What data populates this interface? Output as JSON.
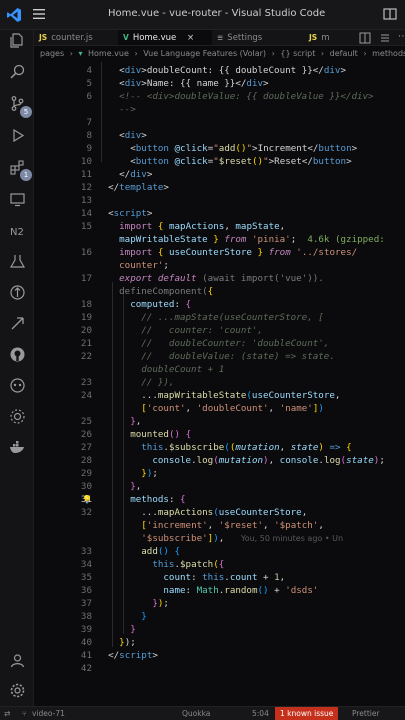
{
  "window": {
    "title": "Home.vue - vue-router - Visual Studio Code"
  },
  "tabs": [
    {
      "icon": "JS",
      "label": "counter.js"
    },
    {
      "icon": "V",
      "label": "Home.vue"
    },
    {
      "icon": "≡",
      "label": "Settings"
    },
    {
      "icon": "JS",
      "label": "m"
    }
  ],
  "breadcrumb": {
    "items": [
      "pages",
      "›",
      "Home.vue",
      "›",
      "Vue Language Features (Volar)",
      "›",
      "{} script",
      "›",
      "default",
      "›",
      "methods"
    ]
  },
  "activity_bar": {
    "badges": {
      "source_control": "5",
      "extensions": "1"
    }
  },
  "editor": {
    "lines": [
      {
        "n": "4",
        "html": "    <span class=\"p\">&lt;</span><span class=\"t\">div</span><span class=\"p\">&gt;doubleCount: {{ doubleCount }}&lt;/</span><span class=\"t\">div</span><span class=\"p\">&gt;</span>"
      },
      {
        "n": "5",
        "html": "    <span class=\"p\">&lt;</span><span class=\"t\">div</span><span class=\"p\">&gt;Name: {{ name }}&lt;/</span><span class=\"t\">div</span><span class=\"p\">&gt;</span>"
      },
      {
        "n": "6",
        "html": "    <span class=\"cm\">&lt;!-- &lt;div&gt;doubleValue: {{ doubleValue }}&lt;/div&gt;</span>"
      },
      {
        "n": "",
        "html": "    <span class=\"cm\">--&gt;</span>"
      },
      {
        "n": "7",
        "html": ""
      },
      {
        "n": "8",
        "html": "    <span class=\"p\">&lt;</span><span class=\"t\">div</span><span class=\"p\">&gt;</span>"
      },
      {
        "n": "9",
        "html": "      <span class=\"p\">&lt;</span><span class=\"t\">button</span> <span class=\"a\">@click</span><span class=\"p\">=</span><span class=\"s\">\"</span><span class=\"f\">add</span><span class=\"y\">()</span><span class=\"s\">\"</span><span class=\"p\">&gt;Increment&lt;/</span><span class=\"t\">button</span><span class=\"p\">&gt;</span>"
      },
      {
        "n": "10",
        "html": "      <span class=\"p\">&lt;</span><span class=\"t\">button</span> <span class=\"a\">@click</span><span class=\"p\">=</span><span class=\"s\">\"</span><span class=\"f\">$reset</span><span class=\"y\">()</span><span class=\"s\">\"</span><span class=\"p\">&gt;Reset&lt;/</span><span class=\"t\">button</span><span class=\"p\">&gt;</span>"
      },
      {
        "n": "11",
        "html": "    <span class=\"p\">&lt;/</span><span class=\"t\">div</span><span class=\"p\">&gt;</span>"
      },
      {
        "n": "12",
        "html": "  <span class=\"p\">&lt;/</span><span class=\"t\">template</span><span class=\"p\">&gt;</span>"
      },
      {
        "n": "13",
        "html": ""
      },
      {
        "n": "14",
        "html": "  <span class=\"p\">&lt;</span><span class=\"t\">script</span><span class=\"p\">&gt;</span>"
      },
      {
        "n": "15",
        "html": "    <span class=\"k\">import</span> <span class=\"y\">{</span> <span class=\"v\">mapActions</span>, <span class=\"v\">mapState</span>,"
      },
      {
        "n": "",
        "html": "    <span class=\"v\">mapWritableState</span> <span class=\"y\">}</span> <span class=\"kit\">from</span> <span class=\"s\">'pinia'</span>;  <span class=\"hint\">4.6k (gzipped:</span>"
      },
      {
        "n": "16",
        "html": "    <span class=\"k\">import</span> <span class=\"y\">{</span> <span class=\"v\">useCounterStore</span> <span class=\"y\">}</span> <span class=\"kit\">from</span> <span class=\"s\">'../stores/</span>"
      },
      {
        "n": "",
        "html": "    <span class=\"s\">counter'</span>;"
      },
      {
        "n": "17",
        "html": "    <span class=\"kit\">export default</span> <span class=\"gray\">(await import('vue')).</span>"
      },
      {
        "n": "",
        "html": "    <span class=\"gray\">defineComponent(</span><span class=\"y\">{</span>"
      },
      {
        "n": "18",
        "html": "      <span class=\"v\">computed</span>: <span class=\"pi\">{</span>"
      },
      {
        "n": "19",
        "html": "        <span class=\"cm\">// ...mapState(useCounterStore, [</span>"
      },
      {
        "n": "20",
        "html": "        <span class=\"cm\">//   counter: 'count',</span>"
      },
      {
        "n": "21",
        "html": "        <span class=\"cm\">//   doubleCounter: 'doubleCount',</span>"
      },
      {
        "n": "22",
        "html": "        <span class=\"cm\">//   doubleValue: (state) =&gt; state.</span>"
      },
      {
        "n": "",
        "html": "        <span class=\"cm\">doubleCount + 1</span>"
      },
      {
        "n": "23",
        "html": "        <span class=\"cm\">// }),</span>"
      },
      {
        "n": "24",
        "html": "        ...<span class=\"f\">mapWritableState</span><span class=\"bl\">(</span><span class=\"v\">useCounterStore</span>,"
      },
      {
        "n": "",
        "html": "        <span class=\"y\">[</span><span class=\"s\">'count'</span>, <span class=\"s\">'doubleCount'</span>, <span class=\"s\">'name'</span><span class=\"y\">]</span><span class=\"bl\">)</span>"
      },
      {
        "n": "25",
        "html": "      <span class=\"pi\">}</span>,"
      },
      {
        "n": "26",
        "html": "      <span class=\"f\">mounted</span><span class=\"pi\">()</span> <span class=\"pi\">{</span>"
      },
      {
        "n": "27",
        "html": "        <span class=\"kw\">this</span>.<span class=\"f\">$subscribe</span><span class=\"bl\">(</span><span class=\"y\">(</span><span class=\"pa\">mutation</span>, <span class=\"pa\">state</span><span class=\"y\">)</span> <span class=\"kw\">=&gt;</span> <span class=\"y\">{</span>"
      },
      {
        "n": "28",
        "html": "          <span class=\"v\">console</span>.<span class=\"f\">log</span><span class=\"pi\">(</span><span class=\"pa\">mutation</span><span class=\"pi\">)</span>, <span class=\"v\">console</span>.<span class=\"f\">log</span><span class=\"pi\">(</span><span class=\"pa\">state</span><span class=\"pi\">)</span>;"
      },
      {
        "n": "29",
        "html": "        <span class=\"y\">}</span><span class=\"bl\">)</span>;"
      },
      {
        "n": "30",
        "html": "      <span class=\"pi\">}</span>,"
      },
      {
        "n": "31",
        "html": "      <span class=\"v\">methods</span>: <span class=\"pi\">{</span>"
      },
      {
        "n": "32",
        "html": "        ...<span class=\"f\">mapActions</span><span class=\"bl\">(</span><span class=\"v\">useCounterStore</span>,"
      },
      {
        "n": "",
        "html": "        <span class=\"y\">[</span><span class=\"s\">'increment'</span>, <span class=\"s\">'$reset'</span>, <span class=\"s\">'$patch'</span>,"
      },
      {
        "n": "",
        "html": "        <span class=\"s\">'$subscribe'</span><span class=\"y\">]</span><span class=\"bl\">)</span>,   <span class=\"blame\">You, 50 minutes ago • Un</span>"
      },
      {
        "n": "33",
        "html": "        <span class=\"f\">add</span><span class=\"bl\">()</span> <span class=\"bl\">{</span>"
      },
      {
        "n": "34",
        "html": "          <span class=\"kw\">this</span>.<span class=\"f\">$patch</span><span class=\"y\">(</span><span class=\"pi\">{</span>"
      },
      {
        "n": "35",
        "html": "            <span class=\"v\">count</span>: <span class=\"kw\">this</span>.<span class=\"v\">count</span> + <span class=\"num\">1</span>,"
      },
      {
        "n": "36",
        "html": "            <span class=\"v\">name</span>: <span class=\"g\">Math</span>.<span class=\"f\">random</span><span class=\"bl\">()</span> + <span class=\"s\">'dsds'</span>"
      },
      {
        "n": "37",
        "html": "          <span class=\"pi\">}</span><span class=\"y\">)</span>;"
      },
      {
        "n": "38",
        "html": "        <span class=\"bl\">}</span>"
      },
      {
        "n": "39",
        "html": "      <span class=\"pi\">}</span>"
      },
      {
        "n": "40",
        "html": "    <span class=\"y\">}</span>);"
      },
      {
        "n": "41",
        "html": "  <span class=\"p\">&lt;/</span><span class=\"t\">script</span><span class=\"p\">&gt;</span>"
      },
      {
        "n": "42",
        "html": ""
      }
    ]
  },
  "status_bar": {
    "items": [
      "video-71",
      "Quokka",
      "5:04",
      "1 known issue",
      "Prettier"
    ]
  },
  "colors": {
    "accent": "#3794ff",
    "status_issue": "#c5301d"
  }
}
